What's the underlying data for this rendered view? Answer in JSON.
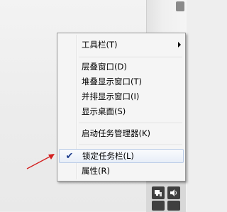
{
  "menu": {
    "items": [
      {
        "label": "工具栏(T)",
        "has_submenu": true
      },
      {
        "label": "层叠窗口(D)"
      },
      {
        "label": "堆叠显示窗口(T)"
      },
      {
        "label": "并排显示窗口(I)"
      },
      {
        "label": "显示桌面(S)"
      },
      {
        "label": "启动任务管理器(K)"
      },
      {
        "label": "锁定任务栏(L)",
        "checked": true,
        "check_mark": "✔"
      },
      {
        "label": "属性(R)"
      }
    ]
  },
  "annotation": {
    "arrow_color": "#d32020"
  },
  "tray": {
    "icons": [
      "speaker-icon",
      "network-icon"
    ]
  }
}
